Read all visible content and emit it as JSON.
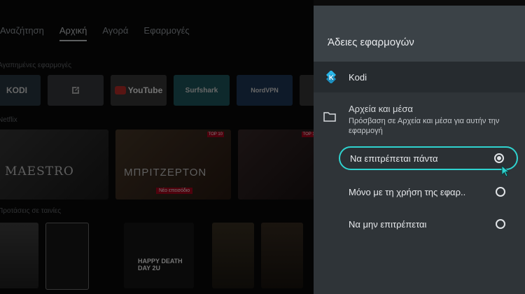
{
  "background": {
    "nav": [
      "Αναζήτηση",
      "Αρχική",
      "Αγορά",
      "Εφαρμογές"
    ],
    "nav_active_index": 1,
    "row_label_apps": "Αγαπημένες εφαρμογές",
    "row_label_netflix": "Netflix",
    "row_label_movies": "Προτάσεις σε ταινίες",
    "apps": [
      "KODI",
      "YouTube",
      "Surfshark",
      "NordVPN"
    ],
    "posters": [
      {
        "title": "MAESTRO",
        "badge": ""
      },
      {
        "title": "ΜΠΡΙΤΖΕΡΤΟΝ",
        "badge": "Νέο επεισόδιο"
      },
      {
        "title": "",
        "badge": ""
      }
    ],
    "top10_label": "TOP 10",
    "movie_text": "HAPPY DEATH DAY 2U"
  },
  "panel": {
    "title": "Άδειες εφαρμογών",
    "app_name": "Kodi",
    "app_icon": "kodi-icon",
    "permission": {
      "title": "Αρχεία και μέσα",
      "description": "Πρόσβαση σε Αρχεία και μέσα για αυτήν την εφαρμογή",
      "icon": "folder-icon"
    },
    "options": [
      {
        "label": "Να επιτρέπεται πάντα",
        "selected": true
      },
      {
        "label": "Μόνο με τη χρήση της εφαρ..",
        "selected": false
      },
      {
        "label": "Να μην επιτρέπεται",
        "selected": false
      }
    ],
    "focus_color": "#2fd3cf"
  }
}
